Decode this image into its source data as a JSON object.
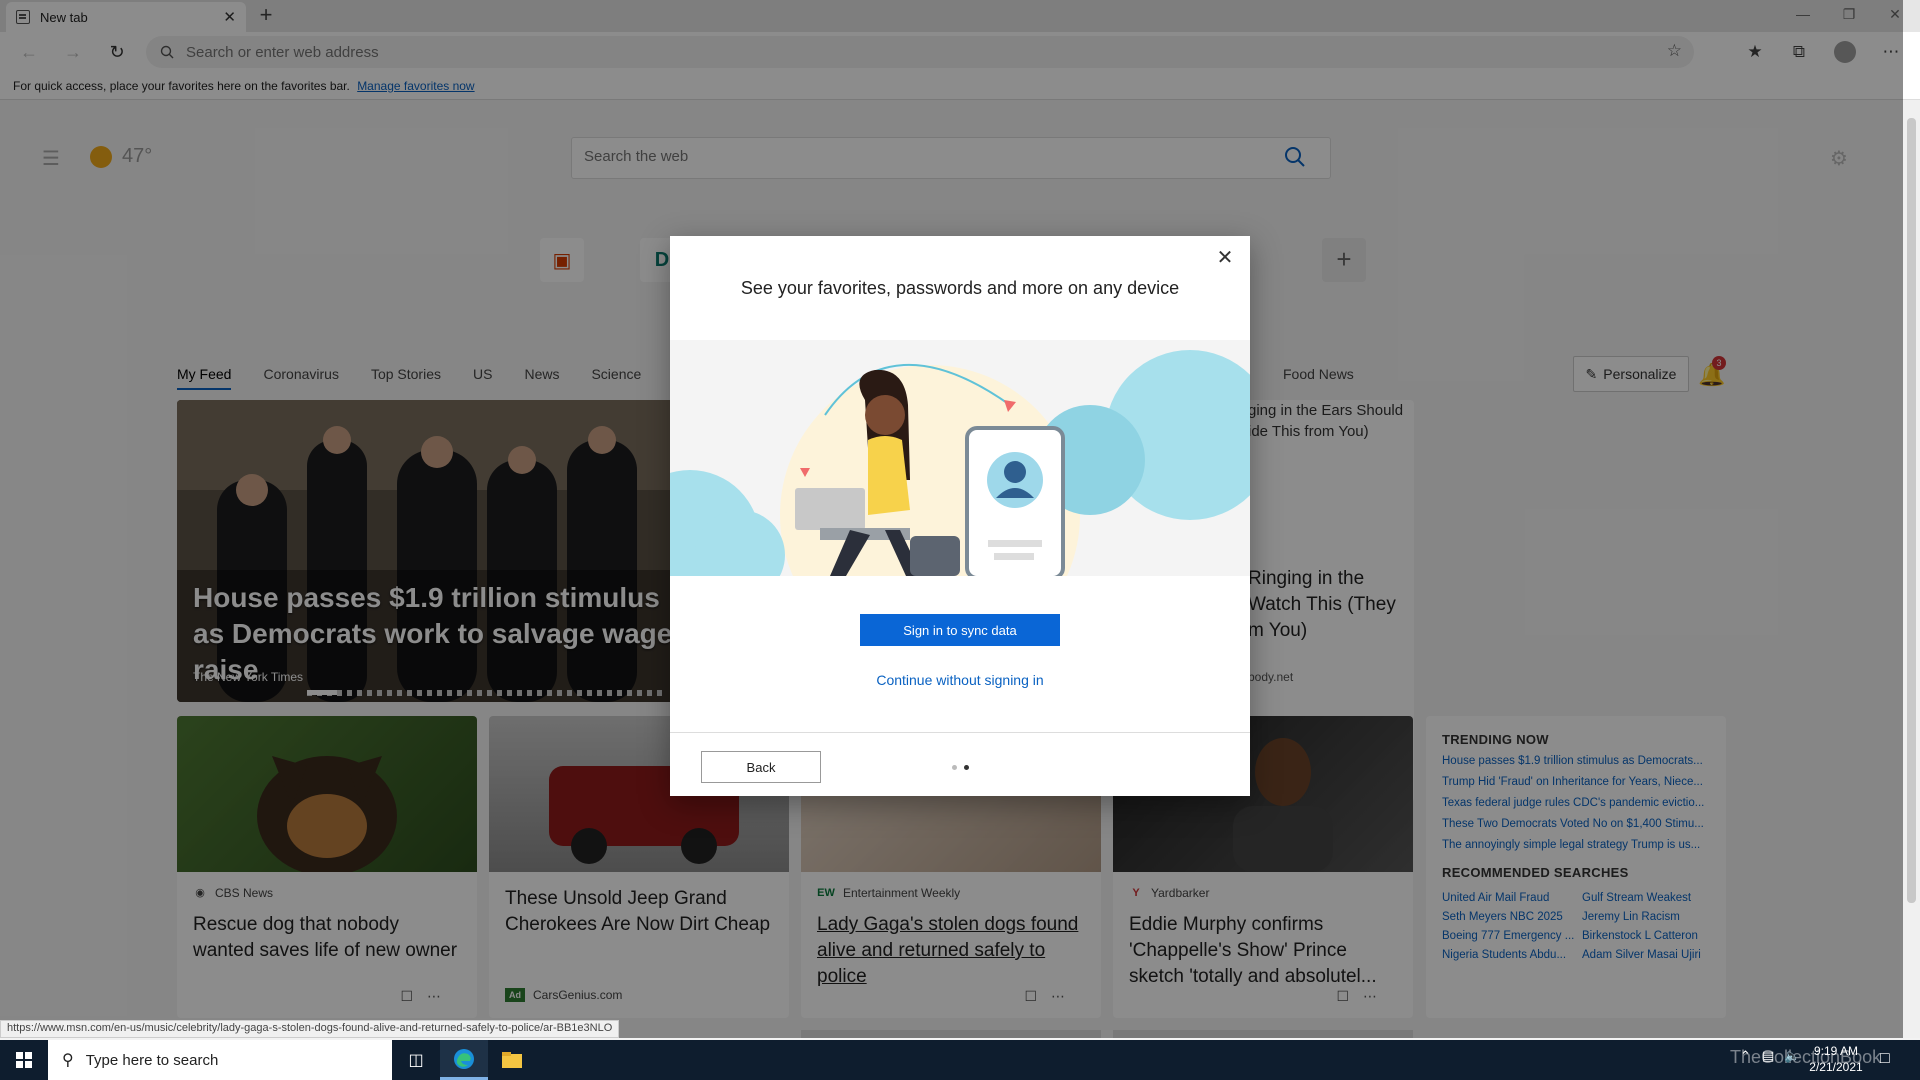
{
  "browser": {
    "tab_title": "New tab",
    "tab_close": "✕",
    "new_tab": "+",
    "address_placeholder": "Search or enter web address",
    "favbar_text": "For quick access, place your favorites here on the favorites bar.",
    "favbar_link": "Manage favorites now"
  },
  "ntp": {
    "weather_temp": "47°",
    "search_placeholder": "Search the web",
    "tabs": [
      "My Feed",
      "Coronavirus",
      "Top Stories",
      "US",
      "News",
      "Science"
    ],
    "tab_right": "Food News",
    "personalize": "Personalize",
    "bell_count": "3",
    "hero": {
      "title": "House passes $1.9 trillion stimulus as Democrats work to salvage wage raise",
      "source": "The New York Times"
    },
    "cards": [
      {
        "source": "CBS News",
        "title": "Rescue dog that nobody wanted saves life of new owner"
      },
      {
        "source": "CarsGenius.com",
        "title": "These Unsold Jeep Grand Cherokees Are Now Dirt Cheap",
        "badge": "Ad"
      },
      {
        "source": "Entertainment Weekly",
        "title": "Lady Gaga's stolen dogs found alive and returned safely to police"
      },
      {
        "source": "Yardbarker",
        "title": "Eddie Murphy confirms 'Chappelle's Show' Prince sketch 'totally and absolutel..."
      }
    ],
    "right_card": {
      "t1": "ging in the Ears Should ide This from You)",
      "t2": "Ringing in the Watch This (They m You)",
      "t3": "body.net"
    },
    "trending": {
      "heading": "TRENDING NOW",
      "items": [
        "House passes $1.9 trillion stimulus as Democrats...",
        "Trump Hid 'Fraud' on Inheritance for Years, Niece...",
        "Texas federal judge rules CDC's pandemic evictio...",
        "These Two Democrats Voted No on $1,400 Stimu...",
        "The annoyingly simple legal strategy Trump is us..."
      ],
      "rec_heading": "RECOMMENDED SEARCHES",
      "recommended": [
        "United Air Mail Fraud",
        "Gulf Stream Weakest",
        "Seth Meyers NBC 2025",
        "Jeremy Lin Racism",
        "Boeing 777 Emergency ...",
        "Birkenstock L Catteron",
        "Nigeria Students Abdu...",
        "Adam Silver Masai Ujiri"
      ]
    }
  },
  "status_url": "https://www.msn.com/en-us/music/celebrity/lady-gaga-s-stolen-dogs-found-alive-and-returned-safely-to-police/ar-BB1e3NLO",
  "modal": {
    "title": "See your favorites, passwords and more on any device",
    "primary": "Sign in to sync data",
    "secondary": "Continue without signing in",
    "back": "Back",
    "close": "✕"
  },
  "taskbar": {
    "search_placeholder": "Type here to search",
    "time": "9:19 AM",
    "date": "2/21/2021",
    "watermark": "TheCollectionBook"
  }
}
